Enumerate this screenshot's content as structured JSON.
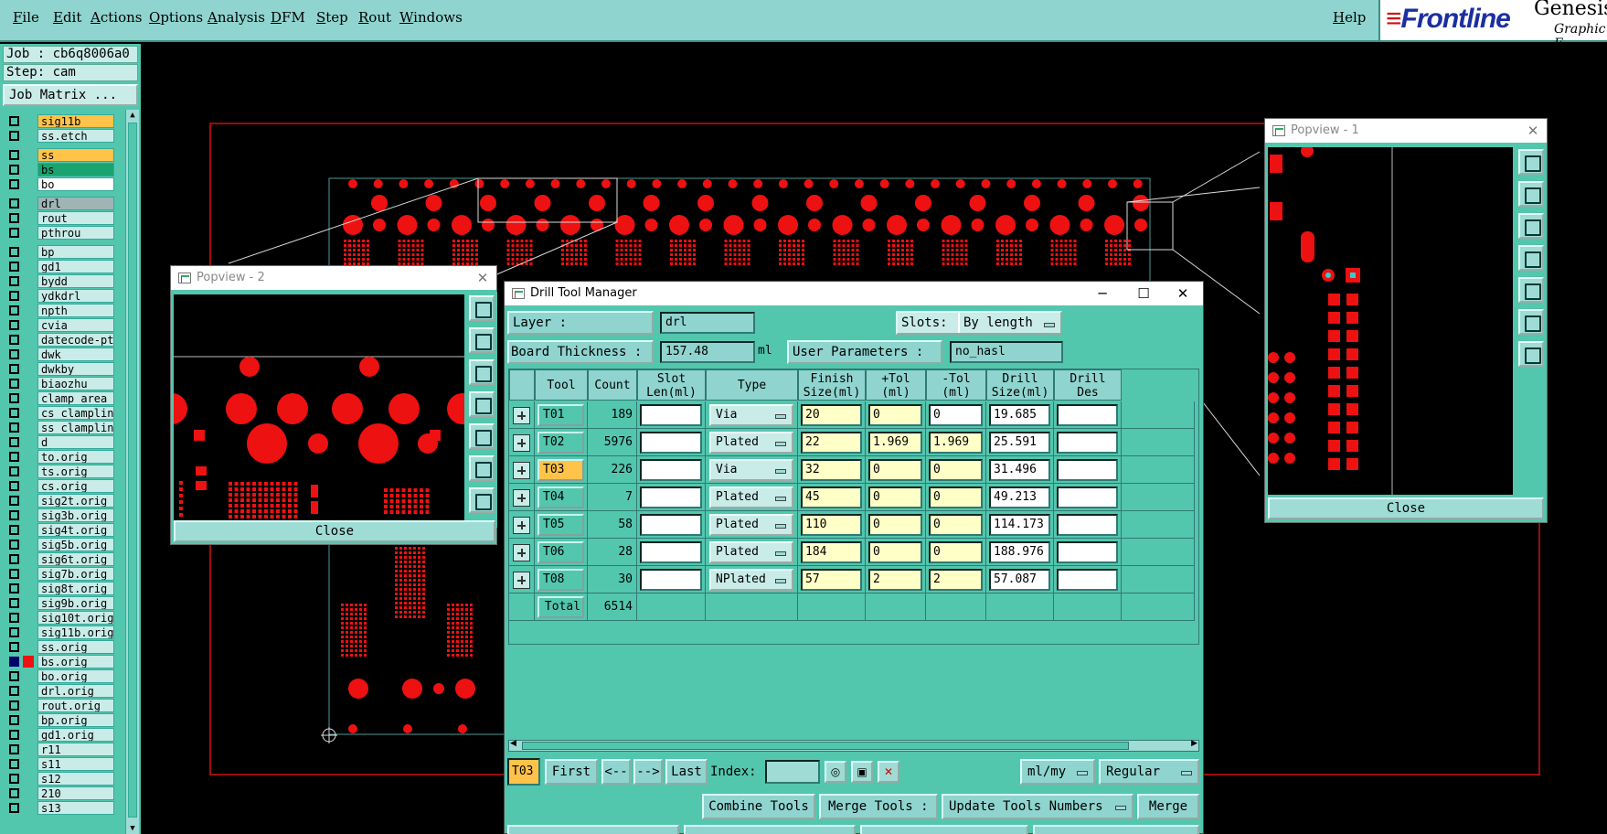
{
  "menubar": {
    "items": [
      "File",
      "Edit",
      "Actions",
      "Options",
      "Analysis",
      "DFM",
      "Step",
      "Rout",
      "Windows"
    ],
    "help": "Help"
  },
  "logo": {
    "brand": "Frontline",
    "product": "Genesis",
    "subtitle": "Graphic E"
  },
  "job": {
    "job_line": "Job : cb6q8006a0",
    "step_line": "Step: cam",
    "job_matrix": "Job Matrix ..."
  },
  "layers": [
    {
      "name": "sig11b",
      "color": "#ffc34a"
    },
    {
      "name": "ss.etch",
      "color": "#c9ece8"
    },
    {
      "name": "ss",
      "color": "#ffc34a"
    },
    {
      "name": "bs",
      "color": "#1aa36f"
    },
    {
      "name": "bo",
      "color": "#ffffff"
    },
    {
      "name": "drl",
      "color": "#9fb5b5"
    },
    {
      "name": "rout",
      "color": "#c9ece8"
    },
    {
      "name": "pthrou",
      "color": "#c9ece8"
    },
    {
      "name": "bp",
      "color": "#c9ece8"
    },
    {
      "name": "gd1",
      "color": "#c9ece8"
    },
    {
      "name": "bydd",
      "color": "#c9ece8"
    },
    {
      "name": "ydkdrl",
      "color": "#c9ece8"
    },
    {
      "name": "npth",
      "color": "#c9ece8"
    },
    {
      "name": "cvia",
      "color": "#c9ece8"
    },
    {
      "name": "datecode-pte",
      "color": "#c9ece8"
    },
    {
      "name": "dwk",
      "color": "#c9ece8"
    },
    {
      "name": "dwkby",
      "color": "#c9ece8"
    },
    {
      "name": "biaozhu",
      "color": "#c9ece8"
    },
    {
      "name": "clamp_area",
      "color": "#c9ece8"
    },
    {
      "name": "cs_clampline",
      "color": "#c9ece8"
    },
    {
      "name": "ss_clampline",
      "color": "#c9ece8"
    },
    {
      "name": "d",
      "color": "#c9ece8"
    },
    {
      "name": "to.orig",
      "color": "#c9ece8"
    },
    {
      "name": "ts.orig",
      "color": "#c9ece8"
    },
    {
      "name": "cs.orig",
      "color": "#c9ece8"
    },
    {
      "name": "sig2t.orig",
      "color": "#c9ece8"
    },
    {
      "name": "sig3b.orig",
      "color": "#c9ece8"
    },
    {
      "name": "sig4t.orig",
      "color": "#c9ece8"
    },
    {
      "name": "sig5b.orig",
      "color": "#c9ece8"
    },
    {
      "name": "sig6t.orig",
      "color": "#c9ece8"
    },
    {
      "name": "sig7b.orig",
      "color": "#c9ece8"
    },
    {
      "name": "sig8t.orig",
      "color": "#c9ece8"
    },
    {
      "name": "sig9b.orig",
      "color": "#c9ece8"
    },
    {
      "name": "sig10t.orig",
      "color": "#c9ece8"
    },
    {
      "name": "sig11b.orig",
      "color": "#c9ece8"
    },
    {
      "name": "ss.orig",
      "color": "#c9ece8"
    },
    {
      "name": "bs.orig",
      "color": "#c9ece8"
    },
    {
      "name": "bo.orig",
      "color": "#c9ece8"
    },
    {
      "name": "drl.orig",
      "color": "#c9ece8"
    },
    {
      "name": "rout.orig",
      "color": "#c9ece8"
    },
    {
      "name": "bp.orig",
      "color": "#c9ece8"
    },
    {
      "name": "gd1.orig",
      "color": "#c9ece8"
    },
    {
      "name": "r11",
      "color": "#c9ece8"
    },
    {
      "name": "s11",
      "color": "#c9ece8"
    },
    {
      "name": "s12",
      "color": "#c9ece8"
    },
    {
      "name": "210",
      "color": "#c9ece8"
    },
    {
      "name": "s13",
      "color": "#c9ece8"
    }
  ],
  "popview2": {
    "title": "Popview - 2",
    "close": "Close"
  },
  "popview1": {
    "title": "Popview - 1",
    "close": "Close"
  },
  "dtm": {
    "title": "Drill Tool Manager",
    "layer_label": "Layer          :",
    "layer_value": "drl",
    "slots_label": "Slots:",
    "slots_value": "By length",
    "thickness_label": "Board Thickness  :",
    "thickness_value": "157.48",
    "thickness_unit": "ml",
    "userparams_label": "User Parameters  :",
    "userparams_value": "no_hasl",
    "columns": [
      "Tool",
      "Count",
      "Slot\nLen(ml)",
      "Type",
      "Finish\nSize(ml)",
      "+Tol\n(ml)",
      "-Tol\n(ml)",
      "Drill\nSize(ml)",
      "Drill\nDes"
    ],
    "rows": [
      {
        "tool": "T01",
        "count": "189",
        "slot": "",
        "type": "Via",
        "finish": "20",
        "ptol": "0",
        "mtol": "0",
        "drill": "19.685",
        "des": ""
      },
      {
        "tool": "T02",
        "count": "5976",
        "slot": "",
        "type": "Plated",
        "finish": "22",
        "ptol": "1.969",
        "mtol": "1.969",
        "drill": "25.591",
        "des": ""
      },
      {
        "tool": "T03",
        "count": "226",
        "slot": "",
        "type": "Via",
        "finish": "32",
        "ptol": "0",
        "mtol": "0",
        "drill": "31.496",
        "des": ""
      },
      {
        "tool": "T04",
        "count": "7",
        "slot": "",
        "type": "Plated",
        "finish": "45",
        "ptol": "0",
        "mtol": "0",
        "drill": "49.213",
        "des": ""
      },
      {
        "tool": "T05",
        "count": "58",
        "slot": "",
        "type": "Plated",
        "finish": "110",
        "ptol": "0",
        "mtol": "0",
        "drill": "114.173",
        "des": ""
      },
      {
        "tool": "T06",
        "count": "28",
        "slot": "",
        "type": "Plated",
        "finish": "184",
        "ptol": "0",
        "mtol": "0",
        "drill": "188.976",
        "des": ""
      },
      {
        "tool": "T08",
        "count": "30",
        "slot": "",
        "type": "NPlated",
        "finish": "57",
        "ptol": "2",
        "mtol": "2",
        "drill": "57.087",
        "des": ""
      }
    ],
    "total_label": "Total",
    "total_count": "6514",
    "nav": {
      "current": "T03",
      "first": "First",
      "prev": "<--",
      "next": "-->",
      "last": "Last",
      "index_label": "Index:",
      "units": "ml/my",
      "mode": "Regular"
    },
    "actions": {
      "combine": "Combine Tools",
      "merge_label": "Merge Tools :",
      "update": "Update Tools Numbers",
      "merge": "Merge"
    }
  }
}
